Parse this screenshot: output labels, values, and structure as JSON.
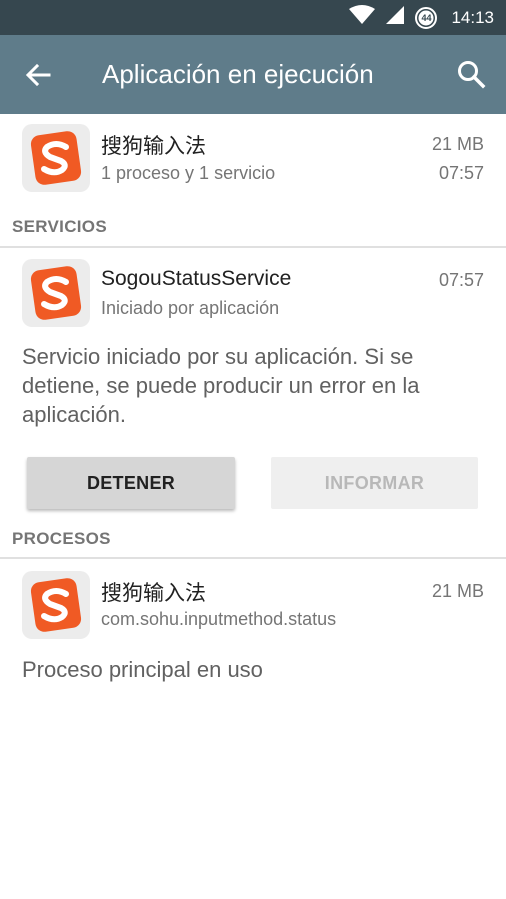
{
  "status_bar": {
    "time": "14:13",
    "battery_level": "44",
    "icons": [
      "wifi-icon",
      "cell-signal-icon",
      "battery-icon"
    ]
  },
  "app_bar": {
    "title": "Aplicación en ejecución",
    "icons": [
      "back-arrow-icon",
      "search-icon"
    ]
  },
  "app_summary": {
    "name": "搜狗输入法",
    "detail": "1 proceso y 1 servicio",
    "size": "21 MB",
    "time": "07:57",
    "icon": "sogou-app-icon"
  },
  "services": {
    "header": "SERVICIOS",
    "item": {
      "name": "SogouStatusService",
      "detail": "Iniciado por aplicación",
      "time": "07:57",
      "icon": "sogou-app-icon"
    },
    "description": "Servicio iniciado por su aplicación. Si se detiene, se puede producir un error en la aplicación.",
    "stop_label": "DETENER",
    "report_label": "INFORMAR"
  },
  "processes": {
    "header": "PROCESOS",
    "item": {
      "name": "搜狗输入法",
      "detail": "com.sohu.inputmethod.status",
      "size": "21 MB",
      "icon": "sogou-app-icon"
    },
    "description": "Proceso principal en uso"
  },
  "colors": {
    "status_bar": "#36474f",
    "app_bar": "#5f7c8a",
    "sogou_orange": "#f05a24"
  }
}
